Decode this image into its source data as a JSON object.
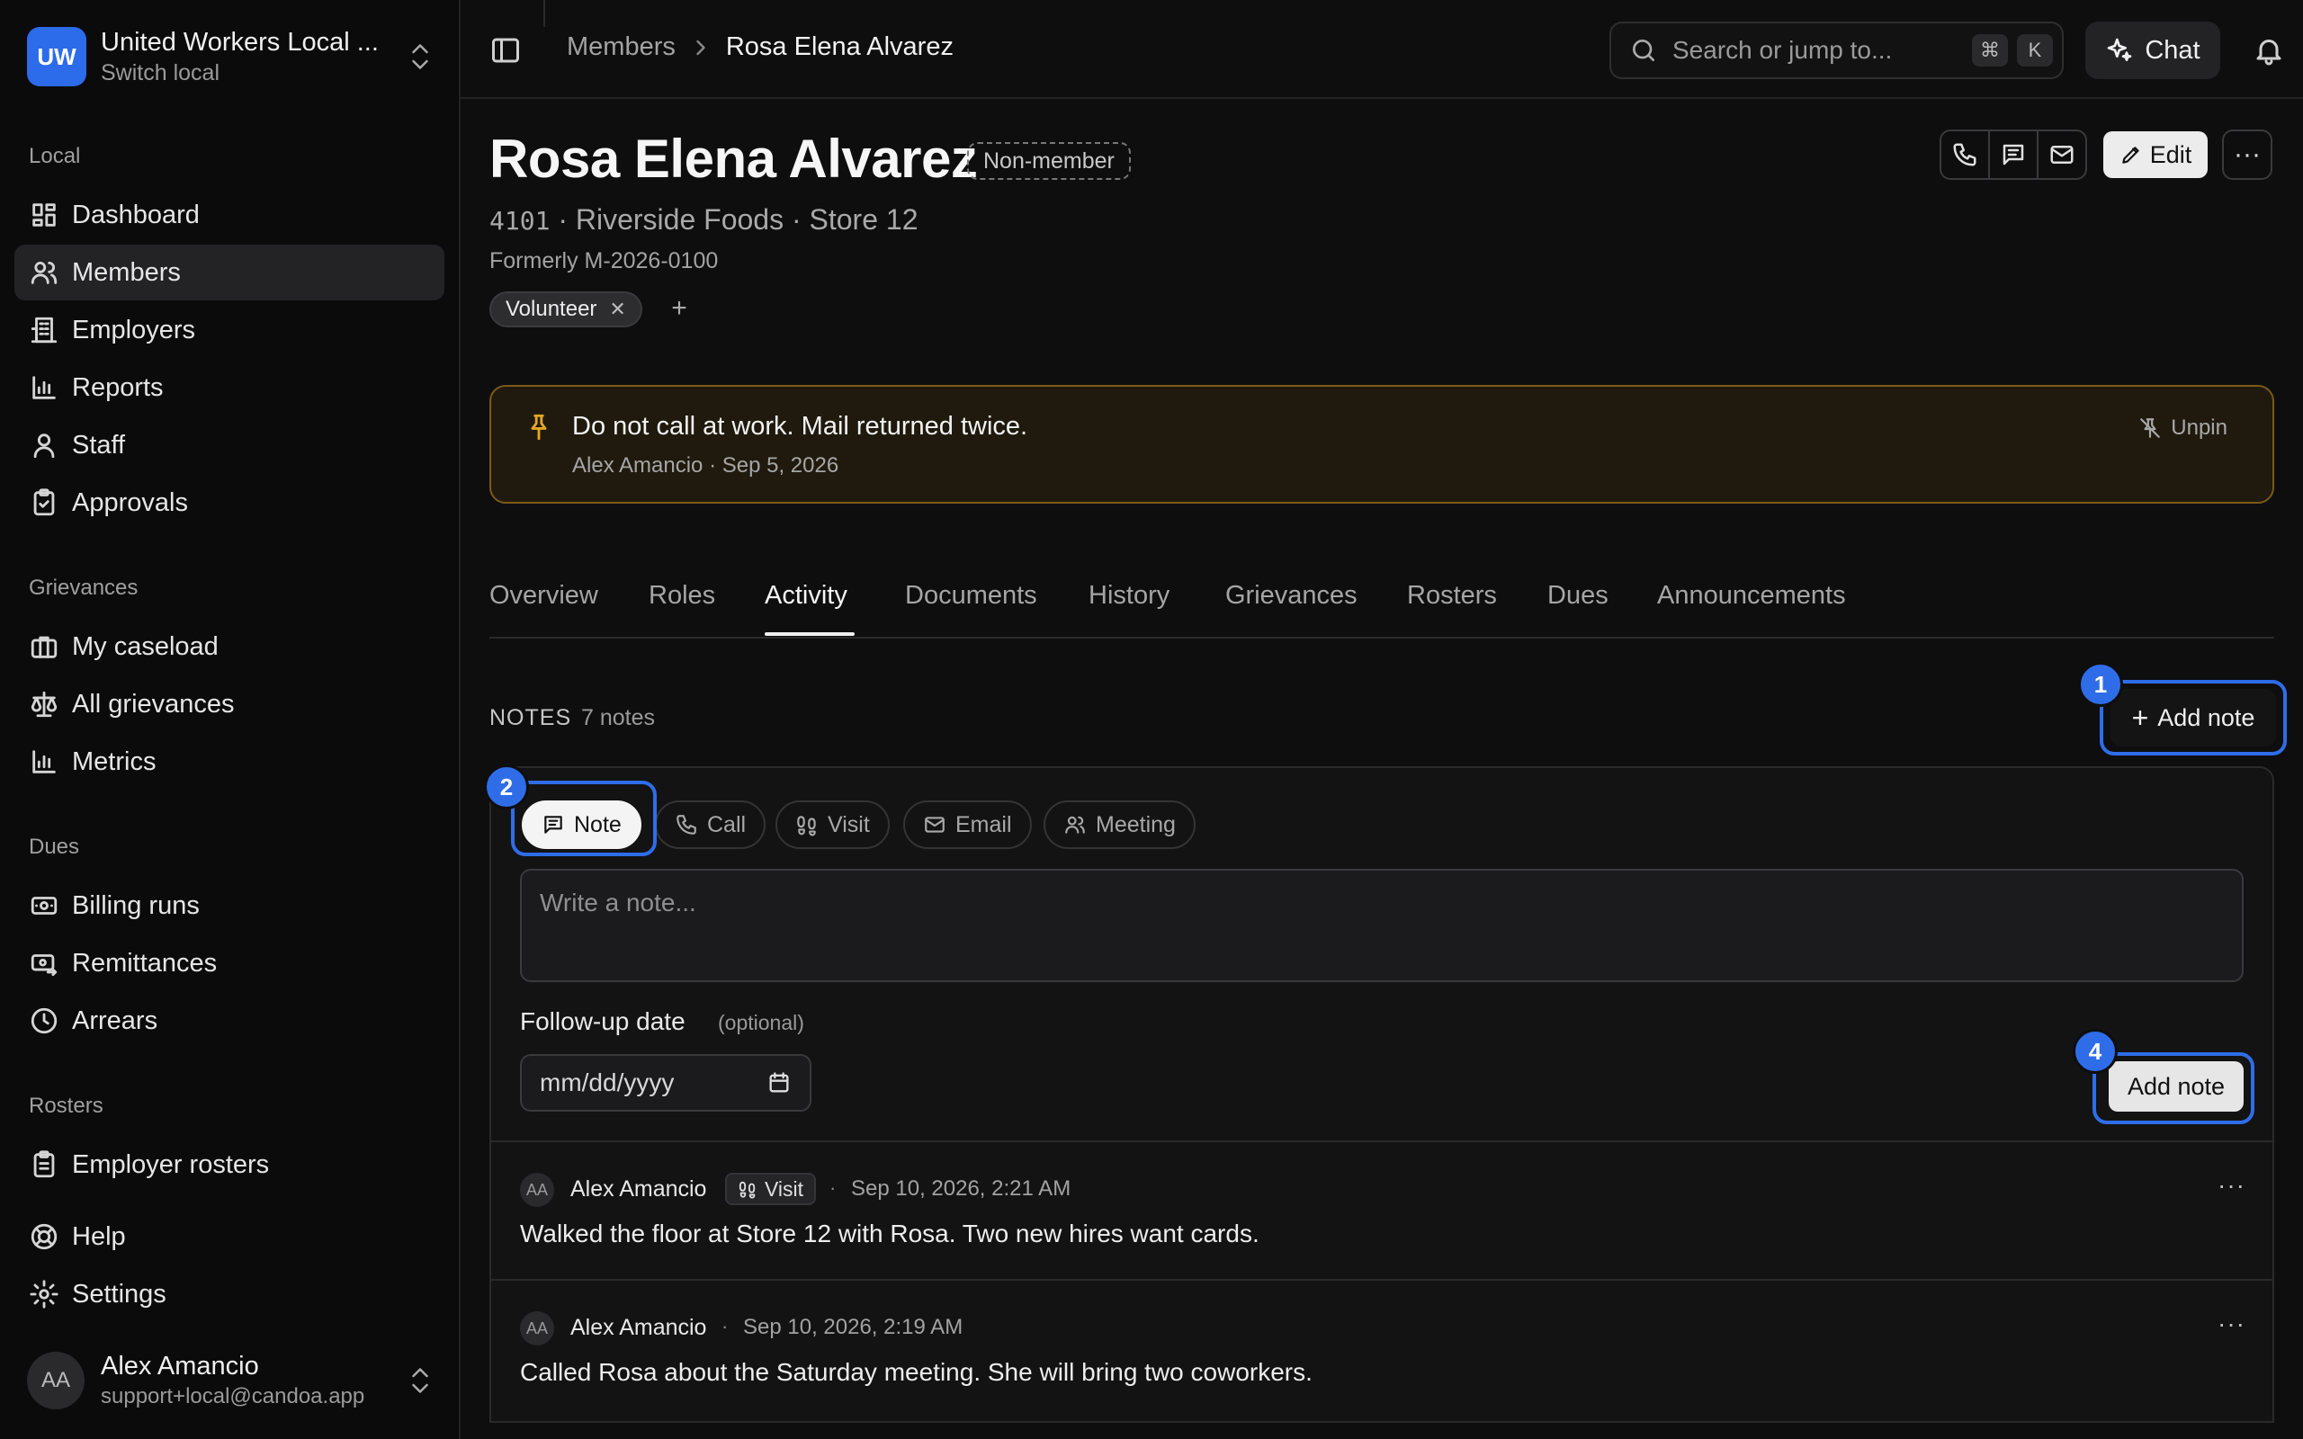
{
  "workspace": {
    "initials": "UW",
    "name": "United Workers Local ...",
    "switch_label": "Switch local"
  },
  "sidebar": {
    "sections": [
      {
        "label": "Local",
        "items": [
          "Dashboard",
          "Members",
          "Employers",
          "Reports",
          "Staff",
          "Approvals"
        ]
      },
      {
        "label": "Grievances",
        "items": [
          "My caseload",
          "All grievances",
          "Metrics"
        ]
      },
      {
        "label": "Dues",
        "items": [
          "Billing runs",
          "Remittances",
          "Arrears"
        ]
      },
      {
        "label": "Rosters",
        "items": [
          "Employer rosters"
        ]
      }
    ],
    "footer_items": [
      "Help",
      "Settings"
    ],
    "active_item": "Members"
  },
  "user": {
    "initials": "AA",
    "name": "Alex Amancio",
    "email": "support+local@candoa.app"
  },
  "topbar": {
    "breadcrumb": [
      "Members",
      "Rosa Elena Alvarez"
    ],
    "search_placeholder": "Search or jump to...",
    "shortcut_keys": [
      "⌘",
      "K"
    ],
    "chat_label": "Chat"
  },
  "member": {
    "name": "Rosa Elena Alvarez",
    "status_badge": "Non-member",
    "id_code": "4101",
    "employer_line": "· Riverside Foods · Store 12",
    "formerly": "Formerly M-2026-0100",
    "tags": [
      "Volunteer"
    ],
    "edit_label": "Edit"
  },
  "pinned_note": {
    "text": "Do not call at work. Mail returned twice.",
    "meta": "Alex Amancio · Sep 5, 2026",
    "unpin_label": "Unpin"
  },
  "tabs": [
    "Overview",
    "Roles",
    "Activity",
    "Documents",
    "History",
    "Grievances",
    "Rosters",
    "Dues",
    "Announcements"
  ],
  "active_tab": "Activity",
  "notes": {
    "heading": "NOTES",
    "count": "7 notes",
    "add_note_label": "Add note",
    "types": [
      "Note",
      "Call",
      "Visit",
      "Email",
      "Meeting"
    ],
    "selected_type": "Note",
    "placeholder": "Write a note...",
    "follow_up_label": "Follow-up date",
    "follow_up_optional": "(optional)",
    "date_placeholder": "mm/dd/yyyy",
    "submit_label": "Add note",
    "items": [
      {
        "initials": "AA",
        "author": "Alex Amancio",
        "type_badge": "Visit",
        "timestamp": "Sep 10, 2026, 2:21 AM",
        "body": "Walked the floor at Store 12 with Rosa. Two new hires want cards."
      },
      {
        "initials": "AA",
        "author": "Alex Amancio",
        "type_badge": "",
        "timestamp": "Sep 10, 2026, 2:19 AM",
        "body": "Called Rosa about the Saturday meeting. She will bring two coworkers."
      }
    ]
  },
  "callouts": [
    "1",
    "2",
    "4"
  ],
  "colors": {
    "accent": "#2f6de8",
    "workspace_logo": "#2c6bea",
    "pinned_border": "#7a5a17",
    "pinned_icon": "#e6a623"
  }
}
